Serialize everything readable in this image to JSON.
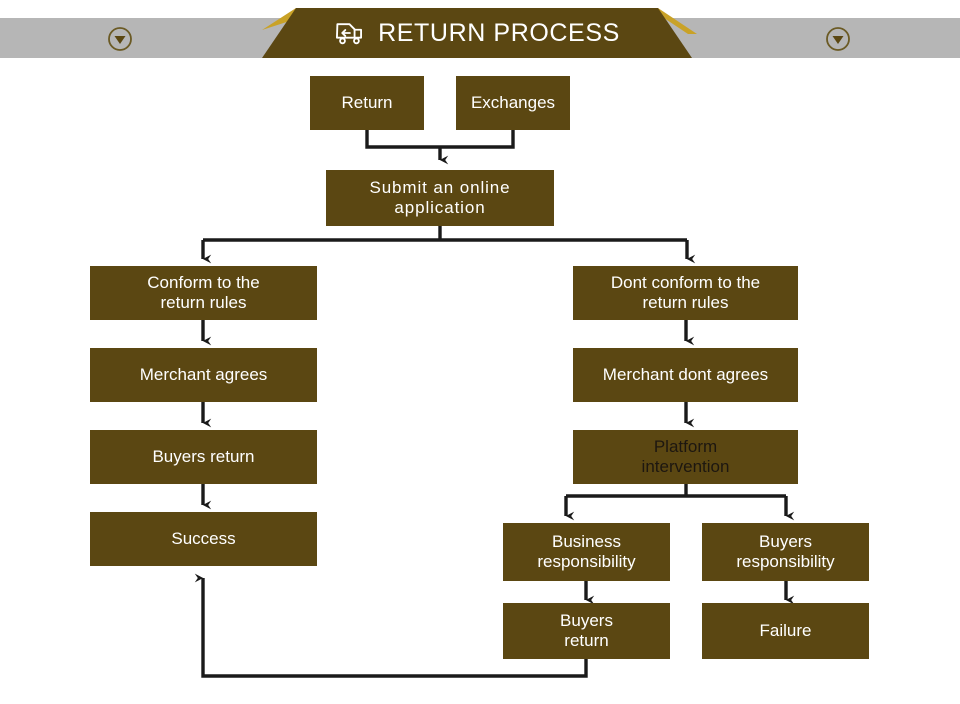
{
  "header": {
    "title": "RETURN PROCESS",
    "icon": "return-truck-icon",
    "left_nav_icon": "chevron-down-circle-icon",
    "right_nav_icon": "chevron-down-circle-icon",
    "banner_color": "#5b4712",
    "accent_color": "#c9a227",
    "bar_color": "#b6b6b6"
  },
  "diagram": {
    "box_color": "#5b4712",
    "text_color": "#ffffff",
    "connector_color": "#1a1a1a",
    "nodes": [
      {
        "id": "return",
        "label": "Return"
      },
      {
        "id": "exchanges",
        "label": "Exchanges"
      },
      {
        "id": "submit",
        "label": "Submit an online\napplication"
      },
      {
        "id": "conform",
        "label": "Conform to the\nreturn rules"
      },
      {
        "id": "merchant-agrees",
        "label": "Merchant agrees"
      },
      {
        "id": "buyers-return-left",
        "label": "Buyers return"
      },
      {
        "id": "success",
        "label": "Success"
      },
      {
        "id": "dont-conform",
        "label": "Dont conform to the\nreturn rules"
      },
      {
        "id": "merchant-dont-agrees",
        "label": "Merchant dont agrees"
      },
      {
        "id": "platform",
        "label": "Platform\nintervention"
      },
      {
        "id": "business-resp",
        "label": "Business\nresponsibility"
      },
      {
        "id": "buyers-resp",
        "label": "Buyers\nresponsibility"
      },
      {
        "id": "buyers-return-right",
        "label": "Buyers\nreturn"
      },
      {
        "id": "failure",
        "label": "Failure"
      }
    ]
  }
}
